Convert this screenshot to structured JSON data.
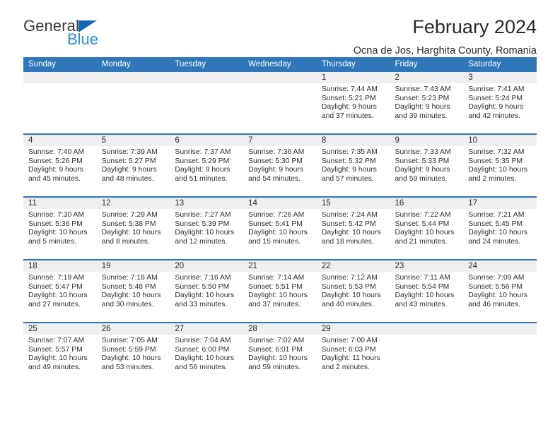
{
  "brand": {
    "name_part1": "General",
    "name_part2": "Blue",
    "triangle_icon": "triangle-icon",
    "colors": {
      "dark": "#3a3a3a",
      "blue": "#2a90d6",
      "triangle": "#1268b3"
    }
  },
  "header": {
    "month_title": "February 2024",
    "location": "Ocna de Jos, Harghita County, Romania"
  },
  "theme": {
    "header_blue": "#2f77b8",
    "daynum_band": "#efefef",
    "text": "#2a2a2a"
  },
  "weekday_headers": [
    "Sunday",
    "Monday",
    "Tuesday",
    "Wednesday",
    "Thursday",
    "Friday",
    "Saturday"
  ],
  "weeks": [
    [
      {
        "day": "",
        "sunrise": "",
        "sunset": "",
        "daylight_line1": "",
        "daylight_line2": ""
      },
      {
        "day": "",
        "sunrise": "",
        "sunset": "",
        "daylight_line1": "",
        "daylight_line2": ""
      },
      {
        "day": "",
        "sunrise": "",
        "sunset": "",
        "daylight_line1": "",
        "daylight_line2": ""
      },
      {
        "day": "",
        "sunrise": "",
        "sunset": "",
        "daylight_line1": "",
        "daylight_line2": ""
      },
      {
        "day": "1",
        "sunrise": "Sunrise: 7:44 AM",
        "sunset": "Sunset: 5:21 PM",
        "daylight_line1": "Daylight: 9 hours",
        "daylight_line2": "and 37 minutes."
      },
      {
        "day": "2",
        "sunrise": "Sunrise: 7:43 AM",
        "sunset": "Sunset: 5:23 PM",
        "daylight_line1": "Daylight: 9 hours",
        "daylight_line2": "and 39 minutes."
      },
      {
        "day": "3",
        "sunrise": "Sunrise: 7:41 AM",
        "sunset": "Sunset: 5:24 PM",
        "daylight_line1": "Daylight: 9 hours",
        "daylight_line2": "and 42 minutes."
      }
    ],
    [
      {
        "day": "4",
        "sunrise": "Sunrise: 7:40 AM",
        "sunset": "Sunset: 5:26 PM",
        "daylight_line1": "Daylight: 9 hours",
        "daylight_line2": "and 45 minutes."
      },
      {
        "day": "5",
        "sunrise": "Sunrise: 7:39 AM",
        "sunset": "Sunset: 5:27 PM",
        "daylight_line1": "Daylight: 9 hours",
        "daylight_line2": "and 48 minutes."
      },
      {
        "day": "6",
        "sunrise": "Sunrise: 7:37 AM",
        "sunset": "Sunset: 5:29 PM",
        "daylight_line1": "Daylight: 9 hours",
        "daylight_line2": "and 51 minutes."
      },
      {
        "day": "7",
        "sunrise": "Sunrise: 7:36 AM",
        "sunset": "Sunset: 5:30 PM",
        "daylight_line1": "Daylight: 9 hours",
        "daylight_line2": "and 54 minutes."
      },
      {
        "day": "8",
        "sunrise": "Sunrise: 7:35 AM",
        "sunset": "Sunset: 5:32 PM",
        "daylight_line1": "Daylight: 9 hours",
        "daylight_line2": "and 57 minutes."
      },
      {
        "day": "9",
        "sunrise": "Sunrise: 7:33 AM",
        "sunset": "Sunset: 5:33 PM",
        "daylight_line1": "Daylight: 9 hours",
        "daylight_line2": "and 59 minutes."
      },
      {
        "day": "10",
        "sunrise": "Sunrise: 7:32 AM",
        "sunset": "Sunset: 5:35 PM",
        "daylight_line1": "Daylight: 10 hours",
        "daylight_line2": "and 2 minutes."
      }
    ],
    [
      {
        "day": "11",
        "sunrise": "Sunrise: 7:30 AM",
        "sunset": "Sunset: 5:36 PM",
        "daylight_line1": "Daylight: 10 hours",
        "daylight_line2": "and 5 minutes."
      },
      {
        "day": "12",
        "sunrise": "Sunrise: 7:29 AM",
        "sunset": "Sunset: 5:38 PM",
        "daylight_line1": "Daylight: 10 hours",
        "daylight_line2": "and 8 minutes."
      },
      {
        "day": "13",
        "sunrise": "Sunrise: 7:27 AM",
        "sunset": "Sunset: 5:39 PM",
        "daylight_line1": "Daylight: 10 hours",
        "daylight_line2": "and 12 minutes."
      },
      {
        "day": "14",
        "sunrise": "Sunrise: 7:26 AM",
        "sunset": "Sunset: 5:41 PM",
        "daylight_line1": "Daylight: 10 hours",
        "daylight_line2": "and 15 minutes."
      },
      {
        "day": "15",
        "sunrise": "Sunrise: 7:24 AM",
        "sunset": "Sunset: 5:42 PM",
        "daylight_line1": "Daylight: 10 hours",
        "daylight_line2": "and 18 minutes."
      },
      {
        "day": "16",
        "sunrise": "Sunrise: 7:22 AM",
        "sunset": "Sunset: 5:44 PM",
        "daylight_line1": "Daylight: 10 hours",
        "daylight_line2": "and 21 minutes."
      },
      {
        "day": "17",
        "sunrise": "Sunrise: 7:21 AM",
        "sunset": "Sunset: 5:45 PM",
        "daylight_line1": "Daylight: 10 hours",
        "daylight_line2": "and 24 minutes."
      }
    ],
    [
      {
        "day": "18",
        "sunrise": "Sunrise: 7:19 AM",
        "sunset": "Sunset: 5:47 PM",
        "daylight_line1": "Daylight: 10 hours",
        "daylight_line2": "and 27 minutes."
      },
      {
        "day": "19",
        "sunrise": "Sunrise: 7:18 AM",
        "sunset": "Sunset: 5:48 PM",
        "daylight_line1": "Daylight: 10 hours",
        "daylight_line2": "and 30 minutes."
      },
      {
        "day": "20",
        "sunrise": "Sunrise: 7:16 AM",
        "sunset": "Sunset: 5:50 PM",
        "daylight_line1": "Daylight: 10 hours",
        "daylight_line2": "and 33 minutes."
      },
      {
        "day": "21",
        "sunrise": "Sunrise: 7:14 AM",
        "sunset": "Sunset: 5:51 PM",
        "daylight_line1": "Daylight: 10 hours",
        "daylight_line2": "and 37 minutes."
      },
      {
        "day": "22",
        "sunrise": "Sunrise: 7:12 AM",
        "sunset": "Sunset: 5:53 PM",
        "daylight_line1": "Daylight: 10 hours",
        "daylight_line2": "and 40 minutes."
      },
      {
        "day": "23",
        "sunrise": "Sunrise: 7:11 AM",
        "sunset": "Sunset: 5:54 PM",
        "daylight_line1": "Daylight: 10 hours",
        "daylight_line2": "and 43 minutes."
      },
      {
        "day": "24",
        "sunrise": "Sunrise: 7:09 AM",
        "sunset": "Sunset: 5:56 PM",
        "daylight_line1": "Daylight: 10 hours",
        "daylight_line2": "and 46 minutes."
      }
    ],
    [
      {
        "day": "25",
        "sunrise": "Sunrise: 7:07 AM",
        "sunset": "Sunset: 5:57 PM",
        "daylight_line1": "Daylight: 10 hours",
        "daylight_line2": "and 49 minutes."
      },
      {
        "day": "26",
        "sunrise": "Sunrise: 7:05 AM",
        "sunset": "Sunset: 5:59 PM",
        "daylight_line1": "Daylight: 10 hours",
        "daylight_line2": "and 53 minutes."
      },
      {
        "day": "27",
        "sunrise": "Sunrise: 7:04 AM",
        "sunset": "Sunset: 6:00 PM",
        "daylight_line1": "Daylight: 10 hours",
        "daylight_line2": "and 56 minutes."
      },
      {
        "day": "28",
        "sunrise": "Sunrise: 7:02 AM",
        "sunset": "Sunset: 6:01 PM",
        "daylight_line1": "Daylight: 10 hours",
        "daylight_line2": "and 59 minutes."
      },
      {
        "day": "29",
        "sunrise": "Sunrise: 7:00 AM",
        "sunset": "Sunset: 6:03 PM",
        "daylight_line1": "Daylight: 11 hours",
        "daylight_line2": "and 2 minutes."
      },
      {
        "day": "",
        "sunrise": "",
        "sunset": "",
        "daylight_line1": "",
        "daylight_line2": ""
      },
      {
        "day": "",
        "sunrise": "",
        "sunset": "",
        "daylight_line1": "",
        "daylight_line2": ""
      }
    ]
  ]
}
